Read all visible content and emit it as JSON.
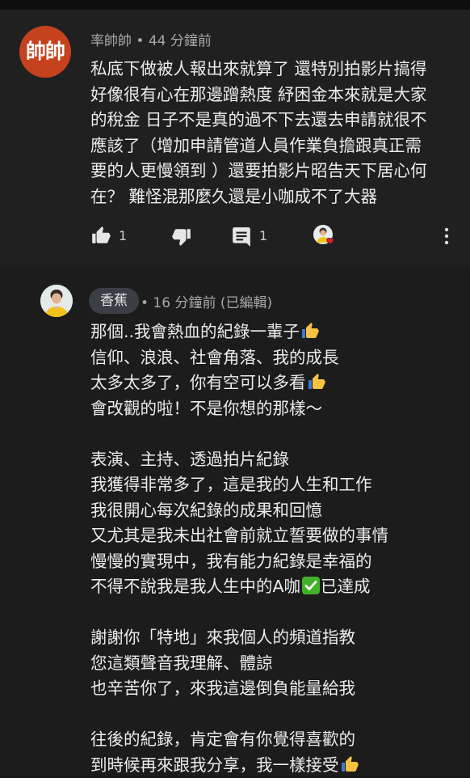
{
  "comments": [
    {
      "avatar_text": "帥帥",
      "author": "率帥帥",
      "time": "44 分鐘前",
      "meta": "率帥帥 • 44 分鐘前",
      "lines": [
        "私底下做被人報出來就算了 還特別拍影片搞得",
        "好像很有心在那邊蹭熱度 紓困金本來就是大家",
        "的稅金 日子不是真的過不下去還去申請就很不",
        "應該了（增加申請管道人員作業負擔跟真正需",
        "要的人更慢領到 ）還要拍影片昭告天下居心何",
        "在？ 難怪混那麼久還是小咖成不了大器"
      ],
      "likes": "1",
      "replies": "1"
    },
    {
      "author": "香蕉",
      "meta": "• 16 分鐘前 (已編輯)",
      "lines": [
        "那個..我會熱血的紀錄一輩子",
        "信仰、浪浪、社會角落、我的成長",
        "太多太多了，你有空可以多看",
        "會改觀的啦！不是你想的那樣～",
        "",
        "表演、主持、透過拍片紀錄",
        "我獲得非常多了，這是我的人生和工作",
        "我很開心每次紀錄的成果和回憶",
        "又尤其是我未出社會前就立誓要做的事情",
        "慢慢的實現中，我有能力紀錄是幸福的",
        "不得不說我是我人生中的A咖",
        "",
        "謝謝你「特地」來我個人的頻道指教",
        "您這類聲音我理解、體諒",
        "也辛苦你了，來我這邊倒負能量給我",
        "",
        "往後的紀錄，肯定會有你覺得喜歡的",
        "到時候再來跟我分享，我一樣接受"
      ],
      "line_11_suffix": "已達成",
      "emojis": {
        "line_1": "thumbs-up-emoji",
        "line_3": "thumbs-up-emoji",
        "line_11": "check-mark-emoji",
        "line_18": "thumbs-up-emoji"
      }
    }
  ],
  "colors": {
    "background": "#181818",
    "comment_bg_1": "#202020",
    "comment_bg_2": "#1c1c1c",
    "avatar_bg": "#c6421f",
    "author_pill_bg": "#3b3f44",
    "text": "#ececec",
    "meta_text": "#a7a7a7",
    "heart": "#e0202a",
    "check_green": "#43b02a",
    "thumb_yellow": "#f5c242"
  },
  "icons": {
    "like": "thumbs-up-icon",
    "dislike": "thumbs-down-icon",
    "reply": "comment-icon",
    "creator_heart": "creator-heart-icon",
    "menu": "more-vert-icon"
  }
}
